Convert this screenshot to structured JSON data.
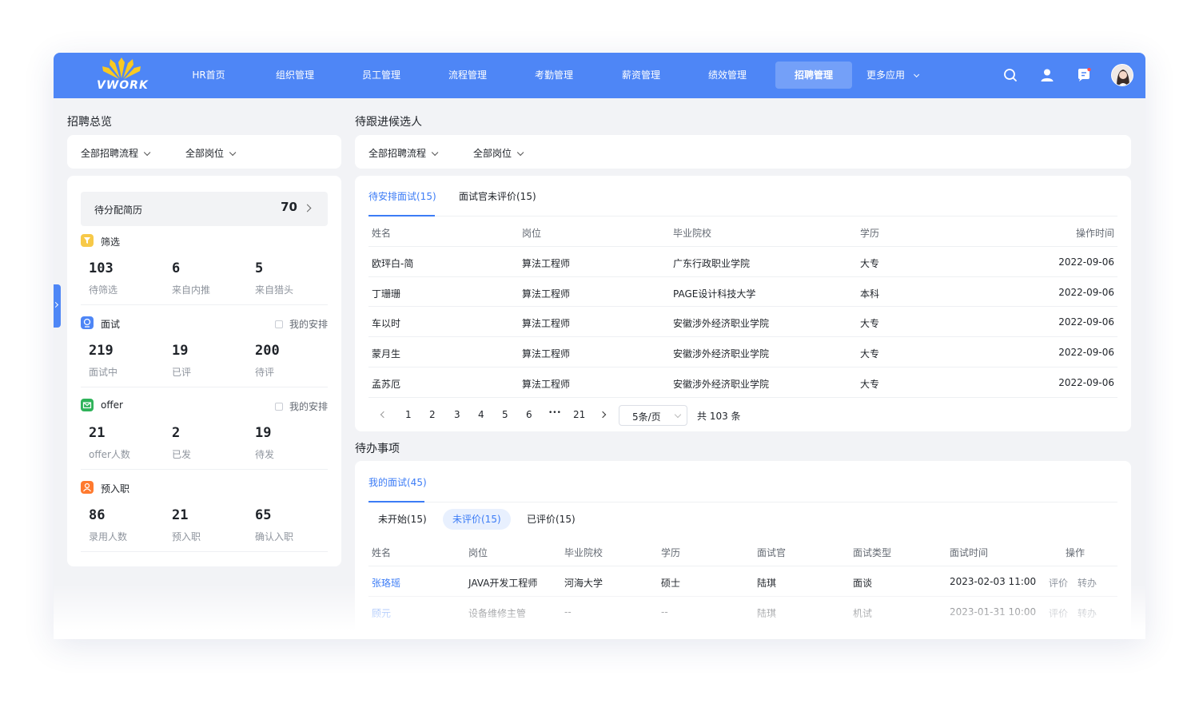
{
  "brand": {
    "logo_text": "VWORK"
  },
  "nav": {
    "items": [
      {
        "label": "HR首页"
      },
      {
        "label": "组织管理"
      },
      {
        "label": "员工管理"
      },
      {
        "label": "流程管理"
      },
      {
        "label": "考勤管理"
      },
      {
        "label": "薪资管理"
      },
      {
        "label": "绩效管理"
      },
      {
        "label": "招聘管理"
      },
      {
        "label": "更多应用"
      }
    ],
    "active": "招聘管理"
  },
  "overview": {
    "title": "招聘总览",
    "filters": {
      "process": "全部招聘流程",
      "position": "全部岗位"
    },
    "pending": {
      "label": "待分配简历",
      "value": "70"
    },
    "groups": [
      {
        "title": "筛选",
        "icon": "filter-icon",
        "color": "#f7c948",
        "my_label": "",
        "stats": [
          {
            "value": "103",
            "label": "待筛选"
          },
          {
            "value": "6",
            "label": "来自内推"
          },
          {
            "value": "5",
            "label": "来自猎头"
          }
        ]
      },
      {
        "title": "面试",
        "icon": "interview-icon",
        "color": "#4e86f6",
        "my_label": "我的安排",
        "stats": [
          {
            "value": "219",
            "label": "面试中"
          },
          {
            "value": "19",
            "label": "已评"
          },
          {
            "value": "200",
            "label": "待评"
          }
        ]
      },
      {
        "title": "offer",
        "icon": "offer-mail-icon",
        "color": "#2fb35a",
        "my_label": "我的安排",
        "stats": [
          {
            "value": "21",
            "label": "offer人数"
          },
          {
            "value": "2",
            "label": "已发"
          },
          {
            "value": "19",
            "label": "待发"
          }
        ]
      },
      {
        "title": "预入职",
        "icon": "person-icon",
        "color": "#ff7a2f",
        "my_label": "",
        "stats": [
          {
            "value": "86",
            "label": "录用人数"
          },
          {
            "value": "21",
            "label": "预入职"
          },
          {
            "value": "65",
            "label": "确认入职"
          }
        ]
      }
    ]
  },
  "candidates": {
    "title": "待跟进候选人",
    "filters": {
      "process": "全部招聘流程",
      "position": "全部岗位"
    },
    "tabs": [
      {
        "label": "待安排面试(15)"
      },
      {
        "label": "面试官未评价(15)"
      }
    ],
    "columns": [
      "姓名",
      "岗位",
      "毕业院校",
      "学历",
      "操作时间"
    ],
    "rows": [
      [
        "欧玶白-简",
        "算法工程师",
        "广东行政职业学院",
        "大专",
        "2022-09-06"
      ],
      [
        "丁珊珊",
        "算法工程师",
        "PAGE设计科技大学",
        "本科",
        "2022-09-06"
      ],
      [
        "车以时",
        "算法工程师",
        "安徽涉外经济职业学院",
        "大专",
        "2022-09-06"
      ],
      [
        "蒙月生",
        "算法工程师",
        "安徽涉外经济职业学院",
        "大专",
        "2022-09-06"
      ],
      [
        "孟苏厄",
        "算法工程师",
        "安徽涉外经济职业学院",
        "大专",
        "2022-09-06"
      ]
    ],
    "pagination": {
      "pages": [
        "1",
        "2",
        "3",
        "4",
        "5",
        "6",
        "•••",
        "21"
      ],
      "page_size": "5条/页",
      "total": "共 103 条"
    }
  },
  "todo": {
    "title": "待办事项",
    "tab": "我的面试(45)",
    "filters": [
      {
        "label": "未开始(15)"
      },
      {
        "label": "未评价(15)"
      },
      {
        "label": "已评价(15)"
      }
    ],
    "active_filter": "未评价(15)",
    "columns": [
      "姓名",
      "岗位",
      "毕业院校",
      "学历",
      "面试官",
      "面试类型",
      "面试时间",
      "操作"
    ],
    "rows": [
      {
        "name": "张珞瑶",
        "position": "JAVA开发工程师",
        "school": "河海大学",
        "degree": "硕士",
        "interviewer": "陆琪",
        "type": "面谈",
        "time": "2023-02-03 11:00",
        "action1": "评价",
        "action2": "转办"
      },
      {
        "name": "顾元",
        "position": "设备维修主管",
        "school": "--",
        "degree": "--",
        "interviewer": "陆琪",
        "type": "机试",
        "time": "2023-01-31 10:00",
        "action1": "评价",
        "action2": "转办"
      }
    ]
  },
  "colors": {
    "primary": "#4e86f6",
    "link": "#3c7cf6",
    "bg": "#f2f3f6"
  }
}
